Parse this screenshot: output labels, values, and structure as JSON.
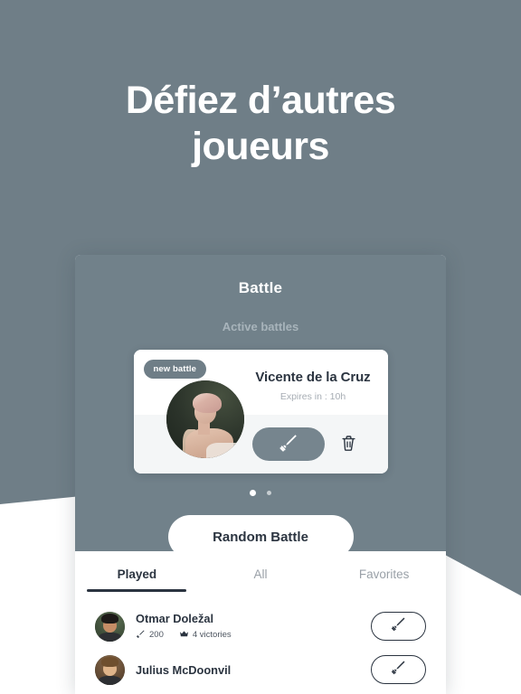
{
  "promo": {
    "headline_line1": "Défiez d’autres",
    "headline_line2": "joueurs"
  },
  "app": {
    "title": "Battle",
    "section_label": "Active battles",
    "battle_card": {
      "badge": "new battle",
      "opponent_name": "Vicente de la Cruz",
      "expires": "Expires in : 10h",
      "fight_icon": "sword-icon",
      "delete_icon": "trash-icon"
    },
    "carousel": {
      "dots": 2,
      "active_index": 0
    },
    "random_battle_label": "Random Battle",
    "tabs": [
      {
        "label": "Played",
        "active": true
      },
      {
        "label": "All",
        "active": false
      },
      {
        "label": "Favorites",
        "active": false
      }
    ],
    "players": [
      {
        "name": "Otmar Doležal",
        "score": "200",
        "victories": "4 victories",
        "score_icon": "sword-icon",
        "victories_icon": "crown-icon",
        "action_icon": "sword-icon"
      },
      {
        "name": "Julius McDoonvil",
        "score": "",
        "victories": "",
        "score_icon": "sword-icon",
        "victories_icon": "crown-icon",
        "action_icon": "sword-icon"
      }
    ]
  },
  "colors": {
    "background": "#6f7e87",
    "panel": "#71818a",
    "accent_dark": "#2b3440",
    "card_footer": "#f4f6f7",
    "muted_text": "#a8b4bb"
  }
}
